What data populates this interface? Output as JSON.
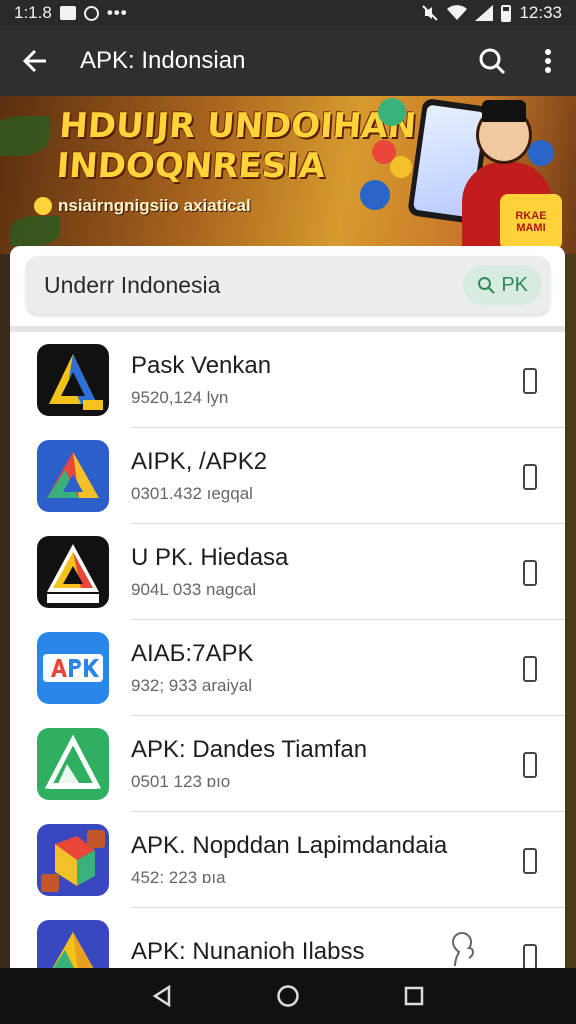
{
  "status_bar": {
    "time_left": "1:1.8",
    "time": "12:33"
  },
  "app_bar": {
    "title": "APK: Indonsian"
  },
  "banner": {
    "headline_1": "HDUIJR UNDOIHAN",
    "headline_2": "INDOQNRESIA",
    "subtitle": "nsiairngnigsiio axiatical",
    "badge": "RKAE MAMI"
  },
  "search": {
    "query": "Underr Indonesia",
    "button_label": "PK"
  },
  "apps": [
    {
      "name": "Pask Venkan",
      "meta": "9520,124 lyn",
      "icon": "delta-triangle-icon"
    },
    {
      "name": "AIPK, /APK2",
      "meta": "0301.432 ıegqal",
      "icon": "colored-triangle-icon"
    },
    {
      "name": "U PK. Hiedasa",
      "meta": "904L 033 nagcal",
      "icon": "gold-triangle-icon"
    },
    {
      "name": "AIAБ:7APK",
      "meta": "932; 933 araiyal",
      "icon": "apk-text-icon"
    },
    {
      "name": "APK: Dandes Tiamfan",
      "meta": "0501 123 ɒıo",
      "icon": "green-triangle-icon"
    },
    {
      "name": "APK. Nopddan Lapimdandaia",
      "meta": "452: 223 ɒıa",
      "icon": "cube-logo-icon"
    },
    {
      "name": "APK: Nunanioh Ilabss",
      "meta": "",
      "icon": "yellow-triangle-icon"
    }
  ],
  "colors": {
    "accent_green": "#2f8a55",
    "app_bar": "#2f2f2f",
    "headline_yellow": "#ffd43a"
  }
}
